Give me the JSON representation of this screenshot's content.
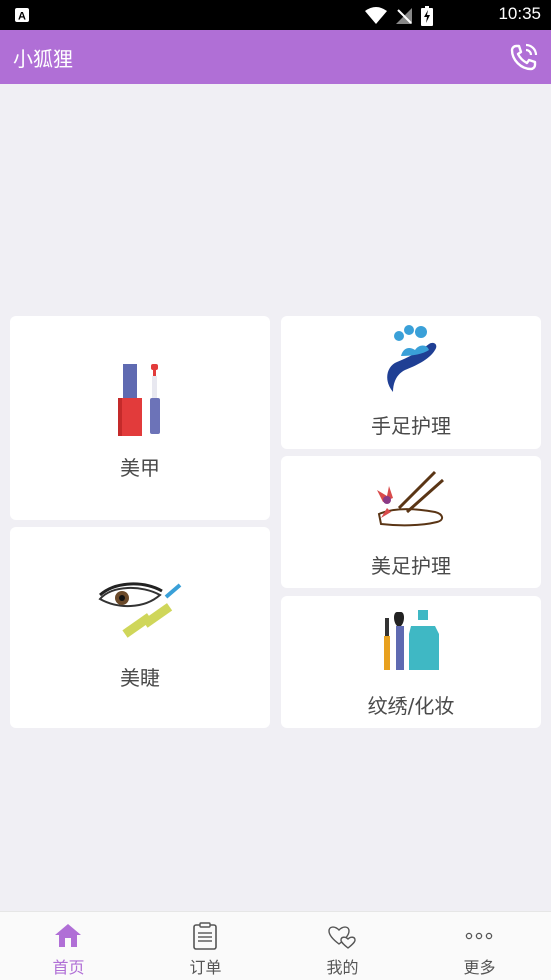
{
  "status_bar": {
    "time": "10:35"
  },
  "app_bar": {
    "title": "小狐狸"
  },
  "services": [
    {
      "label": "美甲"
    },
    {
      "label": "手足护理"
    },
    {
      "label": "美足护理"
    },
    {
      "label": "美睫"
    },
    {
      "label": "纹绣/化妆"
    }
  ],
  "bottom_nav": [
    {
      "label": "首页",
      "icon": "home-icon",
      "active": true
    },
    {
      "label": "订单",
      "icon": "clipboard-icon",
      "active": false
    },
    {
      "label": "我的",
      "icon": "hearts-icon",
      "active": false
    },
    {
      "label": "更多",
      "icon": "more-dots-icon",
      "active": false
    }
  ],
  "colors": {
    "accent": "#b06fd6",
    "background": "#f0eff4"
  }
}
